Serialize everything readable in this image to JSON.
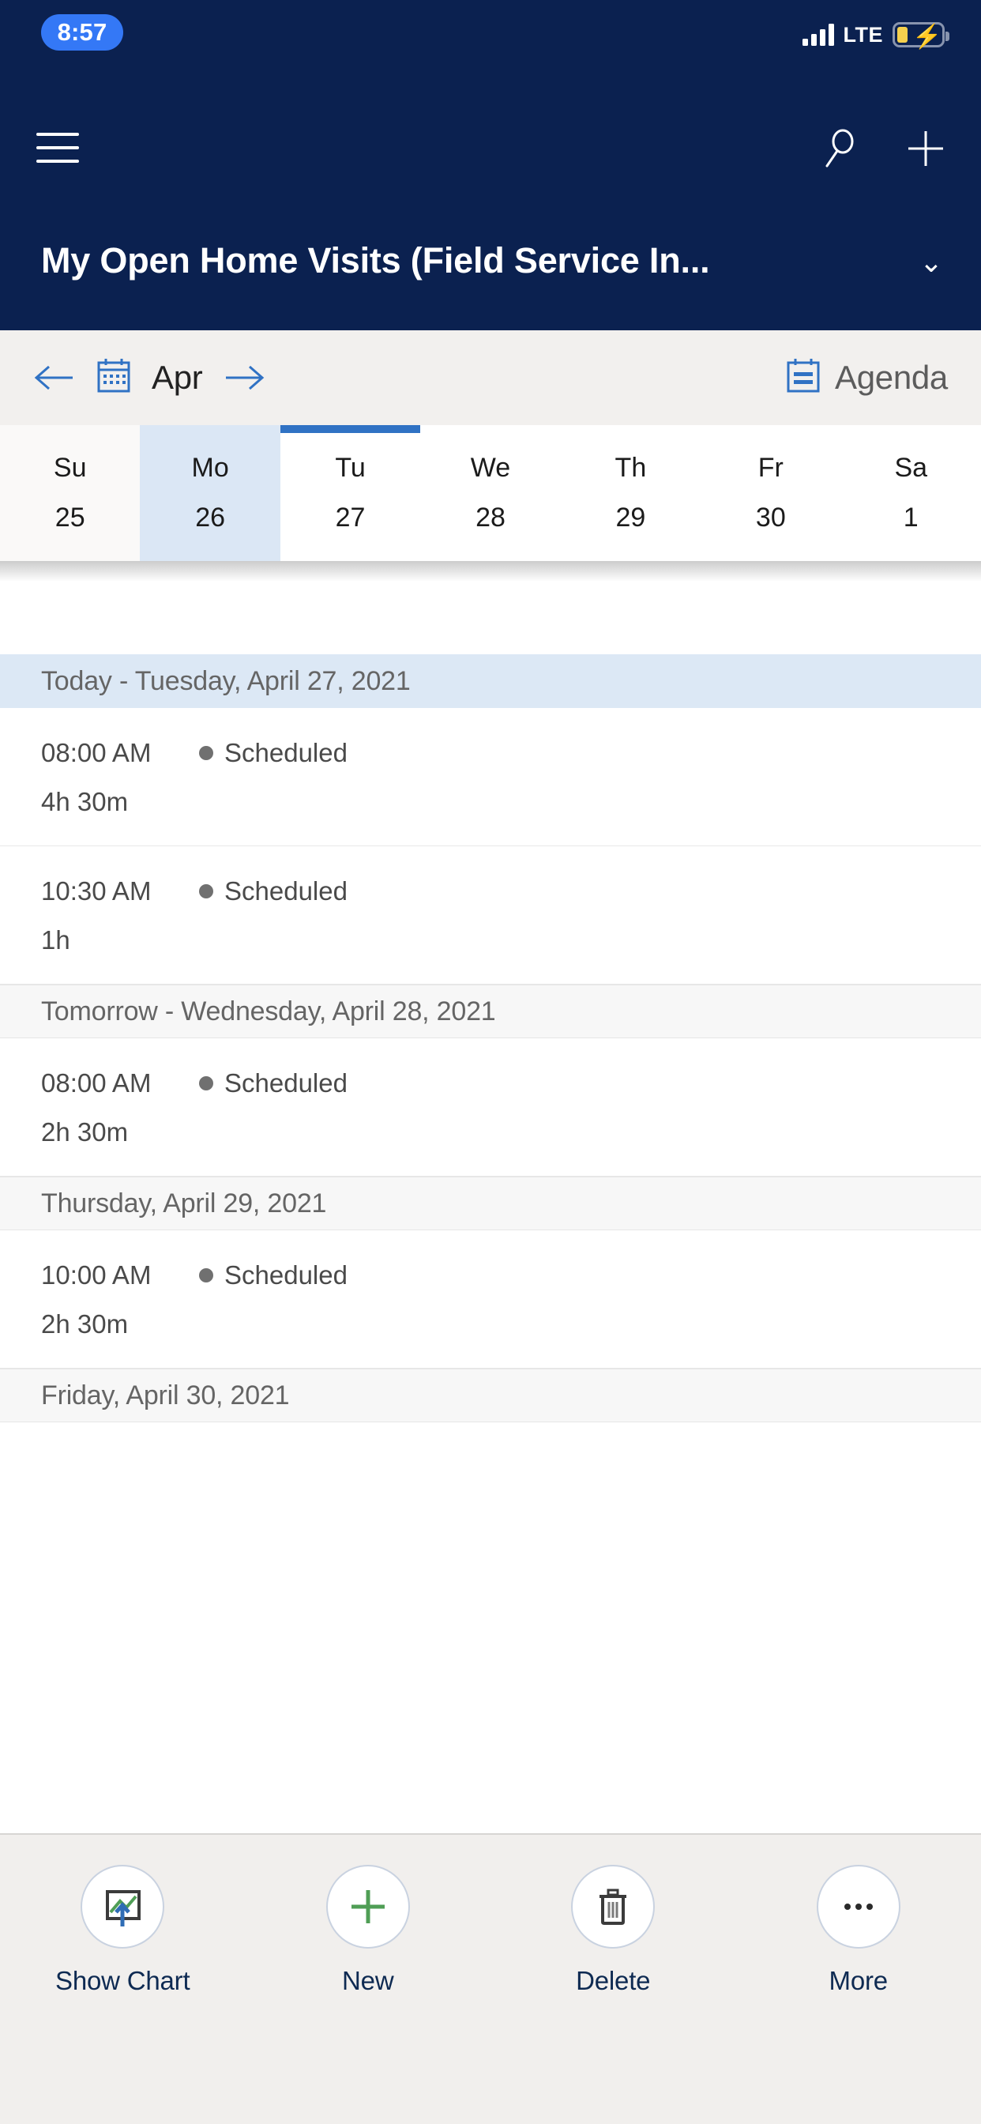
{
  "status_bar": {
    "time": "8:57",
    "network": "LTE",
    "signal_icon": "signal-bars-icon",
    "battery_icon": "battery-charging-icon"
  },
  "nav_bar": {
    "menu_icon": "hamburger-menu-icon",
    "search_icon": "search-icon",
    "add_icon": "plus-icon"
  },
  "header": {
    "title": "My Open Home Visits (Field Service In...",
    "chevron_icon": "chevron-down-icon"
  },
  "calendar_toolbar": {
    "prev_icon": "arrow-left-icon",
    "calendar_icon": "calendar-icon",
    "month": "Apr",
    "next_icon": "arrow-right-icon",
    "view_icon": "agenda-view-icon",
    "view_label": "Agenda"
  },
  "week_strip": {
    "days": [
      {
        "dow": "Su",
        "date": "25",
        "selected": false,
        "today": false
      },
      {
        "dow": "Mo",
        "date": "26",
        "selected": true,
        "today": false
      },
      {
        "dow": "Tu",
        "date": "27",
        "selected": false,
        "today": true
      },
      {
        "dow": "We",
        "date": "28",
        "selected": false,
        "today": false
      },
      {
        "dow": "Th",
        "date": "29",
        "selected": false,
        "today": false
      },
      {
        "dow": "Fr",
        "date": "30",
        "selected": false,
        "today": false
      },
      {
        "dow": "Sa",
        "date": "1",
        "selected": false,
        "today": false
      }
    ]
  },
  "agenda": {
    "sections": [
      {
        "header": "Today - Tuesday, April 27, 2021",
        "is_today": true,
        "appointments": [
          {
            "time": "08:00 AM",
            "status": "Scheduled",
            "duration": "4h 30m"
          },
          {
            "time": "10:30 AM",
            "status": "Scheduled",
            "duration": "1h"
          }
        ]
      },
      {
        "header": "Tomorrow - Wednesday, April 28, 2021",
        "is_today": false,
        "appointments": [
          {
            "time": "08:00 AM",
            "status": "Scheduled",
            "duration": "2h 30m"
          }
        ]
      },
      {
        "header": "Thursday, April 29, 2021",
        "is_today": false,
        "appointments": [
          {
            "time": "10:00 AM",
            "status": "Scheduled",
            "duration": "2h 30m"
          }
        ]
      },
      {
        "header": "Friday, April 30, 2021",
        "is_today": false,
        "appointments": []
      }
    ]
  },
  "command_bar": {
    "items": [
      {
        "label": "Show Chart",
        "icon": "show-chart-icon"
      },
      {
        "label": "New",
        "icon": "plus-icon"
      },
      {
        "label": "Delete",
        "icon": "trash-icon"
      },
      {
        "label": "More",
        "icon": "ellipsis-icon"
      }
    ]
  },
  "colors": {
    "brand_navy": "#0b2150",
    "accent_blue": "#3072c4",
    "selected_day_bg": "#dbe7f5",
    "today_header_bg": "#dce8f5",
    "status_dot": "#707070",
    "new_green": "#4f9e55",
    "time_pill": "#3478f6",
    "battery_low": "#f5d04e"
  }
}
